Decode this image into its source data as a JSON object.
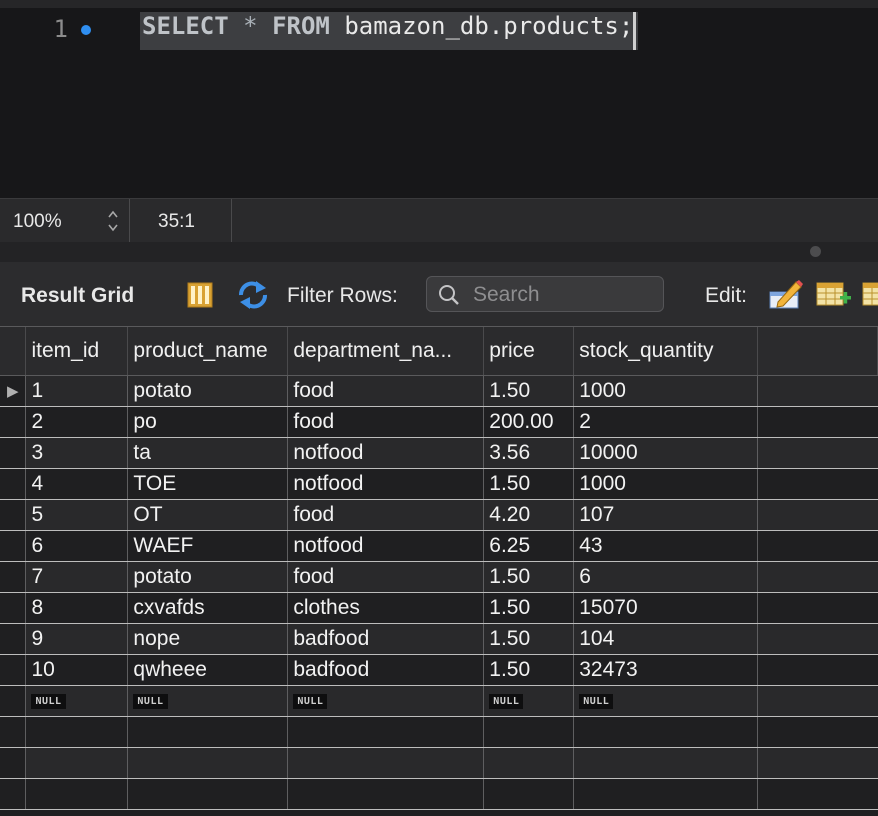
{
  "editor": {
    "line_number": "1",
    "sql": {
      "kw_select": "SELECT",
      "star": "*",
      "kw_from": "FROM",
      "target": "bamazon_db.products;"
    }
  },
  "status": {
    "zoom": "100%",
    "cursor_position": "35:1"
  },
  "toolbar": {
    "result_grid_label": "Result Grid",
    "filter_rows_label": "Filter Rows:",
    "search_placeholder": "Search",
    "edit_label": "Edit:"
  },
  "grid": {
    "columns": [
      "item_id",
      "product_name",
      "department_na...",
      "price",
      "stock_quantity"
    ],
    "rows": [
      [
        "1",
        "potato",
        "food",
        "1.50",
        "1000"
      ],
      [
        "2",
        "po",
        "food",
        "200.00",
        "2"
      ],
      [
        "3",
        "ta",
        "notfood",
        "3.56",
        "10000"
      ],
      [
        "4",
        "TOE",
        "notfood",
        "1.50",
        "1000"
      ],
      [
        "5",
        "OT",
        "food",
        "4.20",
        "107"
      ],
      [
        "6",
        "WAEF",
        "notfood",
        "6.25",
        "43"
      ],
      [
        "7",
        "potato",
        "food",
        "1.50",
        "6"
      ],
      [
        "8",
        "cxvafds",
        "clothes",
        "1.50",
        "15070"
      ],
      [
        "9",
        "nope",
        "badfood",
        "1.50",
        "104"
      ],
      [
        "10",
        "qwheee",
        "badfood",
        "1.50",
        "32473"
      ]
    ],
    "null_label": "NULL",
    "selected_row_marker": "▶"
  },
  "icons": {
    "grid": "grid-layout-icon",
    "refresh": "refresh-icon",
    "search": "search-icon",
    "edit": "edit-pencil-icon",
    "add_row": "add-row-icon",
    "delete_row": "delete-row-icon"
  }
}
